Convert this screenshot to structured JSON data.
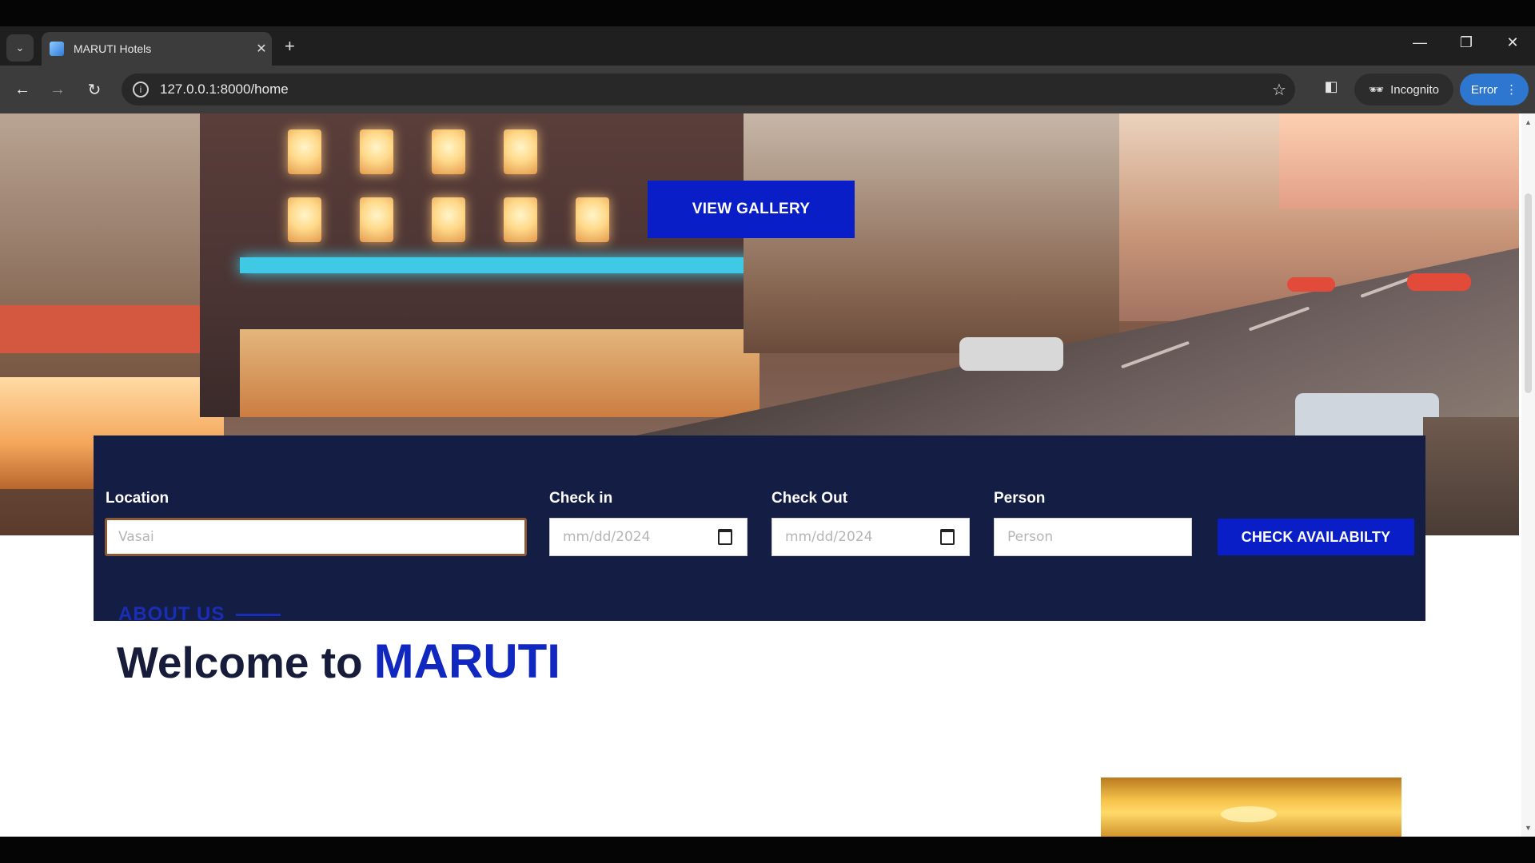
{
  "browser": {
    "tab_title": "MARUTI Hotels",
    "tab_close": "✕",
    "new_tab": "+",
    "url": "127.0.0.1:8000/home",
    "incognito_label": "Incognito",
    "error_label": "Error",
    "window_controls": [
      "—",
      "❐",
      "✕"
    ]
  },
  "hero": {
    "view_gallery_label": "VIEW GALLERY"
  },
  "booking": {
    "location_label": "Location",
    "location_placeholder": "Vasai",
    "checkin_label": "Check in",
    "checkin_placeholder": "mm/dd/2024",
    "checkout_label": "Check Out",
    "checkout_placeholder": "mm/dd/2024",
    "person_label": "Person",
    "person_placeholder": "Person",
    "check_button_label": "CHECK AVAILABILTY"
  },
  "about": {
    "kicker": "ABOUT US",
    "welcome_prefix": "Welcome to",
    "brand": "MARUTI"
  }
}
